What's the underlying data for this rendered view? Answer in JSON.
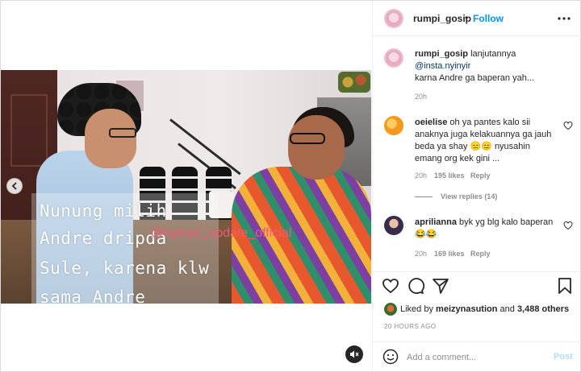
{
  "post": {
    "username": "rumpi_gosip",
    "follow_label": "Follow",
    "separator": "•"
  },
  "video": {
    "caption_lines": [
      "Nunung milih",
      "Andre dripda",
      "Sule, karena klw",
      "sama Andre"
    ],
    "watermark": "@nyinyir_update_official"
  },
  "caption": {
    "username": "rumpi_gosip",
    "text_1": "lanjutannya",
    "mention": "@insta.nyinyir",
    "text_2": "karna Andre ga baperan yah...",
    "time": "20h"
  },
  "comments": [
    {
      "username": "oeielise",
      "text": "oh ya pantes kalo sii anaknya juga kelakuannya ga jauh beda ya shay 😑😑 nyusahin emang org kek gini ...",
      "time": "20h",
      "likes": "195 likes",
      "reply_label": "Reply",
      "view_replies": "View replies (14)"
    },
    {
      "username": "aprilianna",
      "text": "byk yg blg kalo baperan 😂😂",
      "time": "20h",
      "likes": "169 likes",
      "reply_label": "Reply"
    }
  ],
  "likes": {
    "prefix": "Liked by",
    "user": "meizynasution",
    "middle": "and",
    "others": "3,488 others"
  },
  "timestamp": "20 HOURS AGO",
  "add_comment": {
    "placeholder": "Add a comment...",
    "post_label": "Post"
  },
  "icons": {
    "heart": "heart-icon",
    "comment": "comment-icon",
    "share": "share-icon",
    "save": "bookmark-icon",
    "more": "more-icon",
    "mute": "mute-icon",
    "prev": "chevron-left-icon",
    "emoji": "emoji-icon"
  },
  "colors": {
    "follow": "#0095f6",
    "post_disabled": "#b2dffc",
    "watermark": "#f05a78",
    "muted_text": "#8e8e8e"
  }
}
